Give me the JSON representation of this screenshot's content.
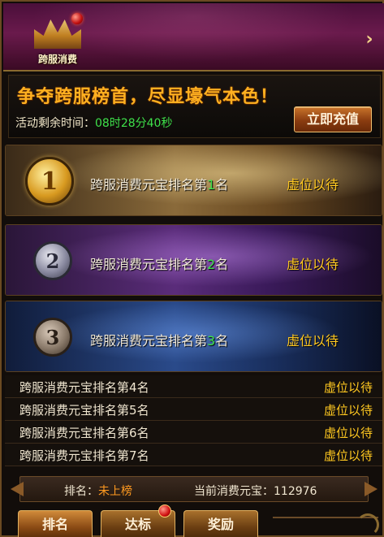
{
  "header": {
    "logo_text": "跨服消费",
    "next_arrow": "›"
  },
  "banner": {
    "slogan": "争夺跨服榜首，尽显壕气本色！",
    "time_label": "活动剩余时间：",
    "time_value": "08时28分40秒",
    "recharge_button": "立即充值"
  },
  "top_ranks": [
    {
      "medal": "1",
      "label_prefix": "跨服消费元宝排名第",
      "num": "1",
      "label_suffix": "名",
      "value": "虚位以待"
    },
    {
      "medal": "2",
      "label_prefix": "跨服消费元宝排名第",
      "num": "2",
      "label_suffix": "名",
      "value": "虚位以待"
    },
    {
      "medal": "3",
      "label_prefix": "跨服消费元宝排名第",
      "num": "3",
      "label_suffix": "名",
      "value": "虚位以待"
    }
  ],
  "rank_list": [
    {
      "label_prefix": "跨服消费元宝排名第",
      "num": "4",
      "label_suffix": "名",
      "value": "虚位以待"
    },
    {
      "label_prefix": "跨服消费元宝排名第",
      "num": "5",
      "label_suffix": "名",
      "value": "虚位以待"
    },
    {
      "label_prefix": "跨服消费元宝排名第",
      "num": "6",
      "label_suffix": "名",
      "value": "虚位以待"
    },
    {
      "label_prefix": "跨服消费元宝排名第",
      "num": "7",
      "label_suffix": "名",
      "value": "虚位以待"
    }
  ],
  "status": {
    "rank_label": "排名：",
    "rank_value": "未上榜",
    "spend_label": "当前消费元宝：",
    "spend_value": "112976"
  },
  "tabs": [
    {
      "label": "排名"
    },
    {
      "label": "达标"
    },
    {
      "label": "奖励"
    }
  ],
  "colors": {
    "gold": "#ffc820",
    "green": "#3ee04a",
    "orange": "#ff9a20"
  }
}
